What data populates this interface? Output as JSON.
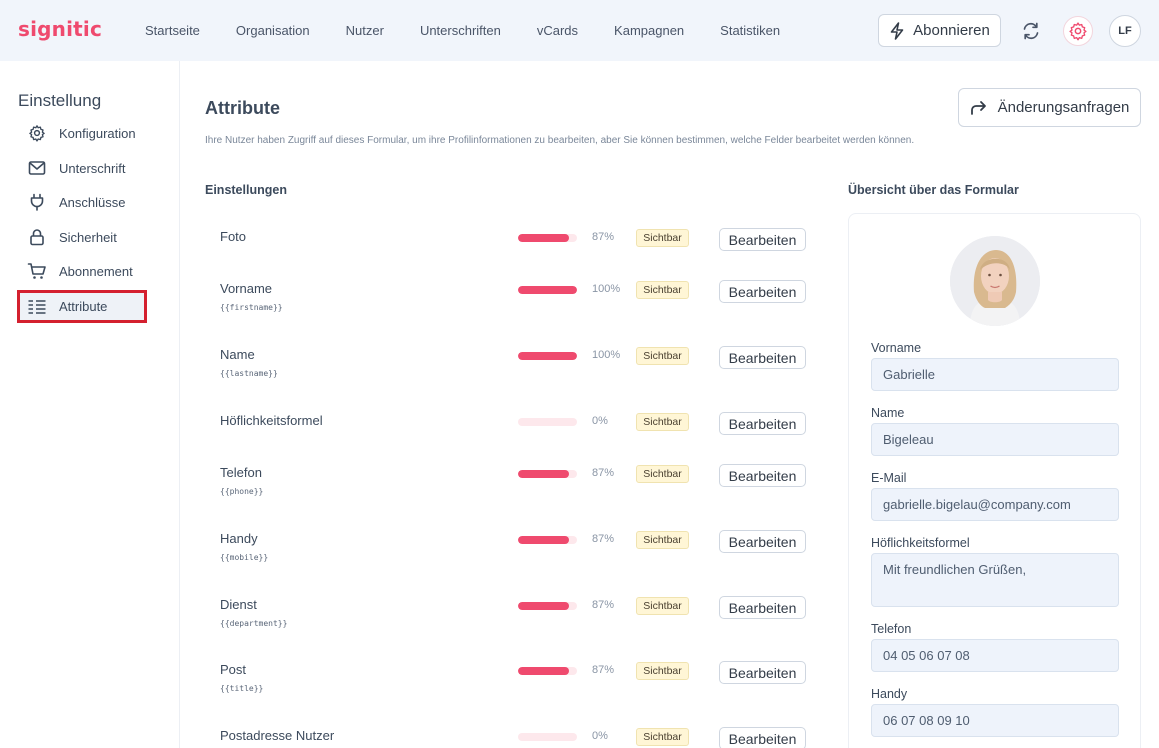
{
  "app": {
    "logo": "signitic"
  },
  "topnav": {
    "items": [
      "Startseite",
      "Organisation",
      "Nutzer",
      "Unterschriften",
      "vCards",
      "Kampagnen",
      "Statistiken"
    ]
  },
  "header": {
    "subscribe_label": "Abonnieren",
    "avatar_initials": "LF"
  },
  "sidebar": {
    "title": "Einstellung",
    "items": [
      {
        "label": "Konfiguration",
        "icon": "gear-icon"
      },
      {
        "label": "Unterschrift",
        "icon": "envelope-icon"
      },
      {
        "label": "Anschlüsse",
        "icon": "plug-icon"
      },
      {
        "label": "Sicherheit",
        "icon": "lock-icon"
      },
      {
        "label": "Abonnement",
        "icon": "cart-icon"
      },
      {
        "label": "Attribute",
        "icon": "list-icon",
        "active": true
      }
    ]
  },
  "main": {
    "title": "Attribute",
    "request_button": "Änderungsanfragen",
    "description": "Ihre Nutzer haben Zugriff auf dieses Formular, um ihre Profilinformationen zu bearbeiten, aber Sie können bestimmen, welche Felder bearbeitet werden können.",
    "settings_heading": "Einstellungen",
    "preview_heading": "Übersicht über das Formular",
    "edit_label": "Bearbeiten",
    "attributes": [
      {
        "name": "Foto",
        "variable": "",
        "percent": 87,
        "percent_label": "87%",
        "status": "Sichtbar"
      },
      {
        "name": "Vorname",
        "variable": "{{firstname}}",
        "percent": 100,
        "percent_label": "100%",
        "status": "Sichtbar"
      },
      {
        "name": "Name",
        "variable": "{{lastname}}",
        "percent": 100,
        "percent_label": "100%",
        "status": "Sichtbar"
      },
      {
        "name": "Höflichkeitsformel",
        "variable": "",
        "percent": 0,
        "percent_label": "0%",
        "status": "Sichtbar"
      },
      {
        "name": "Telefon",
        "variable": "{{phone}}",
        "percent": 87,
        "percent_label": "87%",
        "status": "Sichtbar"
      },
      {
        "name": "Handy",
        "variable": "{{mobile}}",
        "percent": 87,
        "percent_label": "87%",
        "status": "Sichtbar"
      },
      {
        "name": "Dienst",
        "variable": "{{department}}",
        "percent": 87,
        "percent_label": "87%",
        "status": "Sichtbar"
      },
      {
        "name": "Post",
        "variable": "{{title}}",
        "percent": 87,
        "percent_label": "87%",
        "status": "Sichtbar"
      },
      {
        "name": "Postadresse Nutzer",
        "variable": "",
        "percent": 0,
        "percent_label": "0%",
        "status": "Sichtbar"
      }
    ]
  },
  "preview": {
    "fields": [
      {
        "label": "Vorname",
        "value": "Gabrielle"
      },
      {
        "label": "Name",
        "value": "Bigeleau"
      },
      {
        "label": "E-Mail",
        "value": "gabrielle.bigelau@company.com"
      },
      {
        "label": "Höflichkeitsformel",
        "value": "Mit freundlichen Grüßen,"
      },
      {
        "label": "Telefon",
        "value": "04 05 06 07 08"
      },
      {
        "label": "Handy",
        "value": "06 07 08 09 10"
      }
    ]
  },
  "colors": {
    "accent": "#ef4a6e",
    "badge_bg": "#fff6d6",
    "highlight": "#d4202f"
  }
}
